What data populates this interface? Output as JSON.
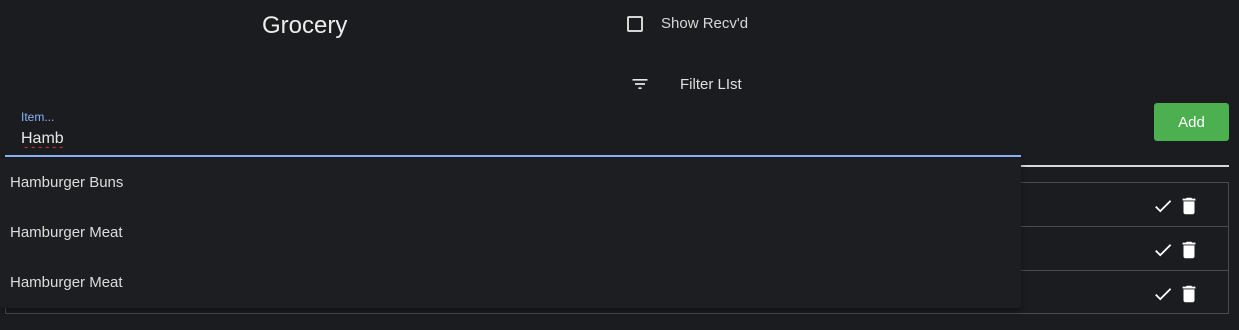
{
  "header": {
    "title": "Grocery",
    "show_recvd_label": "Show Recv'd",
    "show_recvd_checked": false,
    "filter_label": "Filter LIst"
  },
  "item_input": {
    "label": "Item...",
    "value": "Hamb"
  },
  "add_button": {
    "label": "Add"
  },
  "autocomplete": {
    "options": [
      "Hamburger Buns",
      "Hamburger Meat",
      "Hamburger Meat"
    ]
  },
  "icons": {
    "filter": "filter-list-icon",
    "check": "check-icon",
    "delete": "trash-icon"
  },
  "colors": {
    "background": "#1b1c1f",
    "accent": "#8ab4f8",
    "add_button": "#4caf50"
  }
}
